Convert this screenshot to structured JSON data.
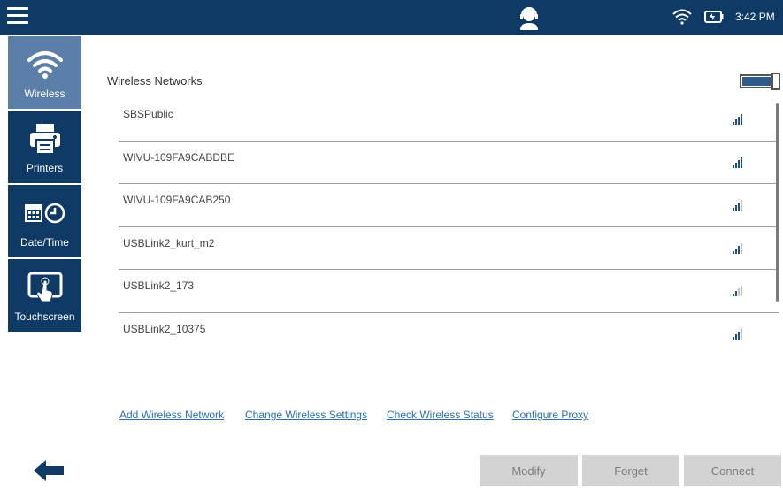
{
  "topbar": {
    "menu_icon": "hamburger-menu-icon",
    "support_icon": "support-agent-icon",
    "wifi_icon": "wifi-icon",
    "battery_icon": "battery-charging-icon",
    "time": "3:42 PM",
    "background": "#0f3a66"
  },
  "sidebar": {
    "items": [
      {
        "label": "Wireless",
        "icon": "wifi-icon",
        "active": true
      },
      {
        "label": "Printers",
        "icon": "printer-icon",
        "active": false
      },
      {
        "label": "Date/Time",
        "icon": "calendar-clock-icon",
        "active": false
      },
      {
        "label": "Touchscreen",
        "icon": "touchscreen-icon",
        "active": false
      }
    ],
    "active_color": "#5b7fa8",
    "inactive_color": "#0f3a66"
  },
  "main": {
    "title": "Wireless Networks",
    "wireless_toggle_on": true,
    "networks": [
      {
        "name": "SBSPublic",
        "signal_bars": 4
      },
      {
        "name": "WIVU-109FA9CABDBE",
        "signal_bars": 4
      },
      {
        "name": "WIVU-109FA9CAB250",
        "signal_bars": 3
      },
      {
        "name": "USBLink2_kurt_m2",
        "signal_bars": 3
      },
      {
        "name": "USBLink2_173",
        "signal_bars": 2
      },
      {
        "name": "USBLink2_10375",
        "signal_bars": 3
      }
    ]
  },
  "links": {
    "add": "Add Wireless Network",
    "change": "Change Wireless Settings",
    "check": "Check Wireless Status",
    "proxy": "Configure Proxy"
  },
  "footer": {
    "back_icon": "back-arrow-icon",
    "modify": "Modify",
    "forget": "Forget",
    "connect": "Connect"
  }
}
